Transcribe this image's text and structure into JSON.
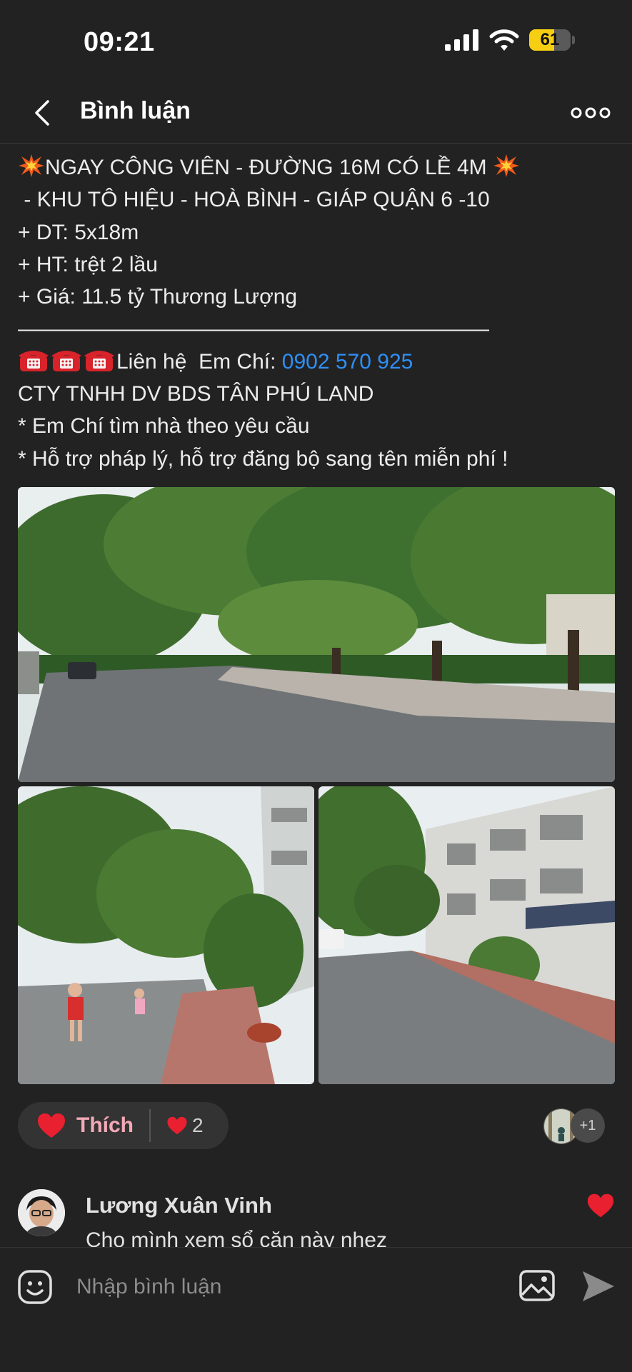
{
  "status_bar": {
    "time": "09:21",
    "battery_level": "61",
    "battery_fraction": 0.61,
    "icons": [
      "cellular-signal-icon",
      "wifi-icon",
      "battery-icon"
    ]
  },
  "header": {
    "title": "Bình luận",
    "back_icon": "chevron-left-icon",
    "more_icon": "more-horizontal-icon"
  },
  "post": {
    "line1": "NGAY CÔNG VIÊN - ĐƯỜNG 16M CÓ LỀ 4M",
    "line2": " - KHU TÔ HIỆU - HOÀ BÌNH - GIÁP QUẬN 6 -10",
    "line3": "+ DT: 5x18m",
    "line4": "+ HT: trệt 2 lầu",
    "line5": "+ Giá: 11.5 tỷ Thương Lượng",
    "divider": "——————————————————————",
    "contact_prefix": "Liên hệ  Em Chí: ",
    "phone": "0902 570 925",
    "company": "CTY TNHH DV BDS TÂN PHÚ LAND",
    "note1": "* Em Chí tìm nhà theo yêu cầu",
    "note2": "* Hỗ trợ pháp lý, hỗ trợ đăng bộ sang tên miễn phí !",
    "emoji": [
      "collision-icon",
      "telephone-icon"
    ]
  },
  "photos": [
    {
      "name": "street-park-photo"
    },
    {
      "name": "street-kids-photo"
    },
    {
      "name": "street-houses-photo"
    }
  ],
  "reactions": {
    "like_label": "Thích",
    "like_count": "2",
    "others_label": "+1",
    "accent_color": "#f4a9b6",
    "heart_color": "#e8202f"
  },
  "comments": [
    {
      "author": "Lương Xuân Vinh",
      "text": "Cho mình xem sổ căn này nhez"
    }
  ],
  "composer": {
    "placeholder": "Nhập bình luận",
    "icons": [
      "emoji-icon",
      "image-icon",
      "send-icon"
    ]
  },
  "colors": {
    "background": "#222222",
    "link": "#2f8ff5",
    "battery": "#f7cf12"
  }
}
